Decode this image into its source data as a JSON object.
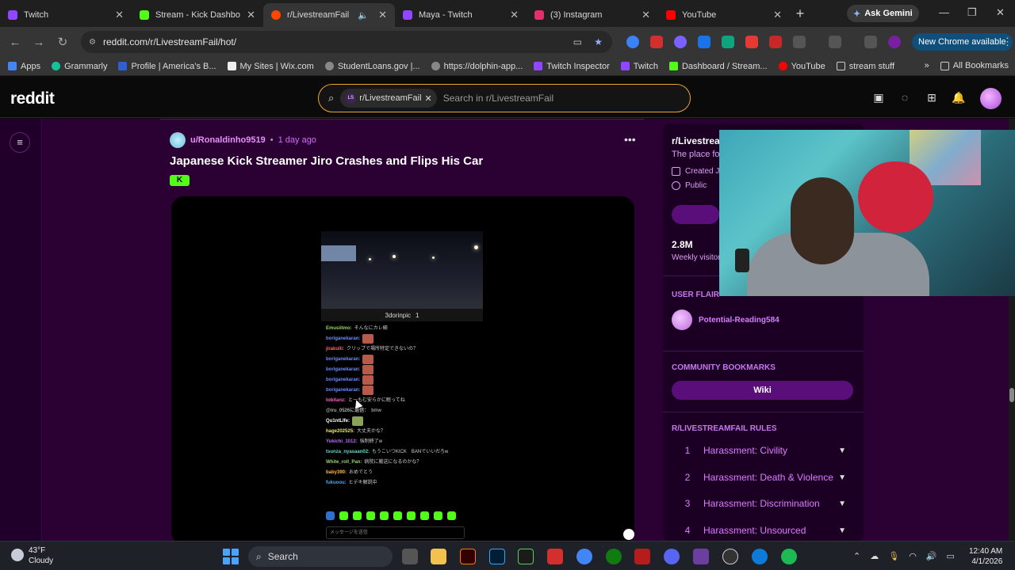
{
  "browser": {
    "tabs": [
      {
        "title": "Twitch",
        "color": "#9146ff"
      },
      {
        "title": "Stream - Kick Dashboar",
        "color": "#53fc18"
      },
      {
        "title": "r/LivestreamFail",
        "color": "#ff4500"
      },
      {
        "title": "Maya - Twitch",
        "color": "#9146ff"
      },
      {
        "title": "(3) Instagram",
        "color": "#e1306c"
      },
      {
        "title": "YouTube",
        "color": "#ff0000"
      }
    ],
    "ask_gemini": "Ask Gemini",
    "url": "reddit.com/r/LivestreamFail/hot/",
    "new_chrome": "New Chrome available",
    "bookmarks": [
      {
        "label": "Apps",
        "color": "#4285f4"
      },
      {
        "label": "Grammarly",
        "color": "#15c39a"
      },
      {
        "label": "Profile | America's B...",
        "color": "#2f5fd0"
      },
      {
        "label": "My Sites | Wix.com",
        "color": "#eeeeee"
      },
      {
        "label": "StudentLoans.gov |...",
        "color": "#888888"
      },
      {
        "label": "https://dolphin-app...",
        "color": "#888888"
      },
      {
        "label": "Twitch Inspector",
        "color": "#9146ff"
      },
      {
        "label": "Twitch",
        "color": "#9146ff"
      },
      {
        "label": "Dashboard / Stream...",
        "color": "#53fc18"
      },
      {
        "label": "YouTube",
        "color": "#ff0000"
      },
      {
        "label": "stream stuff",
        "color": "#cccccc"
      }
    ],
    "bookmarks_more": "»",
    "all_bookmarks": "All Bookmarks"
  },
  "reddit": {
    "logo": "reddit",
    "search_chip": "r/LivestreamFail",
    "search_chip_badge": "LS",
    "search_placeholder": "Search in r/LivestreamFail"
  },
  "post": {
    "author": "u/Ronaldinho9519",
    "separator": "•",
    "time": "1 day ago",
    "title": "Japanese Kick Streamer Jiro Crashes and Flips His Car",
    "flair": "K",
    "video_channel": "3dorinpic",
    "video_viewers": "1",
    "chat_lines": [
      {
        "name": "Emusiitmo:",
        "text": "そんなにカレ細",
        "emote": false,
        "color": "#9ad36a"
      },
      {
        "name": "boriganekaran:",
        "text": "",
        "emote": true,
        "color": "#6a8cff"
      },
      {
        "name": "jirakulii:",
        "text": "クリップで場所特定できないの？",
        "emote": false,
        "color": "#ff6b6b"
      },
      {
        "name": "boriganekaran:",
        "text": "",
        "emote": true,
        "color": "#6a8cff"
      },
      {
        "name": "boriganekaran:",
        "text": "",
        "emote": true,
        "color": "#6a8cff"
      },
      {
        "name": "boriganekaran:",
        "text": "",
        "emote": true,
        "color": "#6a8cff"
      },
      {
        "name": "boriganekaran:",
        "text": "",
        "emote": true,
        "color": "#6a8cff"
      },
      {
        "name": "tobitanz:",
        "text": "とーもむ安らかに眠ってね",
        "emote": false,
        "color": "#ff5ec9"
      },
      {
        "name": "@iru_0526に返信：",
        "text": "bmw",
        "emote": false,
        "color": "#aaaaaa"
      },
      {
        "name": "Qu1ntLlfe:",
        "text": "",
        "emote": true,
        "color": "#ffffff"
      },
      {
        "name": "hage202525:",
        "text": "大丈夫かな？",
        "emote": false,
        "color": "#e8e86a"
      },
      {
        "name": "Yukichi_1012:",
        "text": "強制終了w",
        "emote": false,
        "color": "#c069ff"
      },
      {
        "name": "tsunza_nyasaan02:",
        "text": "もうこいつKICK　BANでいいだろw",
        "emote": false,
        "color": "#6ad3c0"
      },
      {
        "name": "White_roll_Pan:",
        "text": "病院に搬送になるのかな？",
        "emote": false,
        "color": "#9ad36a"
      },
      {
        "name": "baby390:",
        "text": "おめでとう",
        "emote": false,
        "color": "#ffb84a"
      },
      {
        "name": "fukuoou:",
        "text": "ヒデキ解説中",
        "emote": false,
        "color": "#4aa8ff"
      }
    ],
    "chat_placeholder": "メッセージを送信"
  },
  "sidebar": {
    "title": "r/Livestrea",
    "description": "The place fo",
    "created": "Created J",
    "visibility": "Public",
    "members": "2.8M",
    "visitors_label": "Weekly visitor",
    "user_flair_heading": "USER FLAIR",
    "user_flair_name": "Potential-Reading584",
    "bookmarks_heading": "COMMUNITY BOOKMARKS",
    "wiki_label": "Wiki",
    "rules_heading": "R/LIVESTREAMFAIL RULES",
    "rules": [
      {
        "num": "1",
        "text": "Harassment: Civility"
      },
      {
        "num": "2",
        "text": "Harassment: Death & Violence"
      },
      {
        "num": "3",
        "text": "Harassment: Discrimination"
      },
      {
        "num": "4",
        "text": "Harassment: Unsourced"
      }
    ]
  },
  "taskbar": {
    "temp": "43°F",
    "condition": "Cloudy",
    "search_label": "Search",
    "time": "12:40 AM",
    "date": "4/1/2026"
  },
  "colors": {
    "reddit_bg": "#2b0033",
    "accent_pink": "#d26bff",
    "kick_green": "#53fc18",
    "search_border": "#e8a634"
  }
}
